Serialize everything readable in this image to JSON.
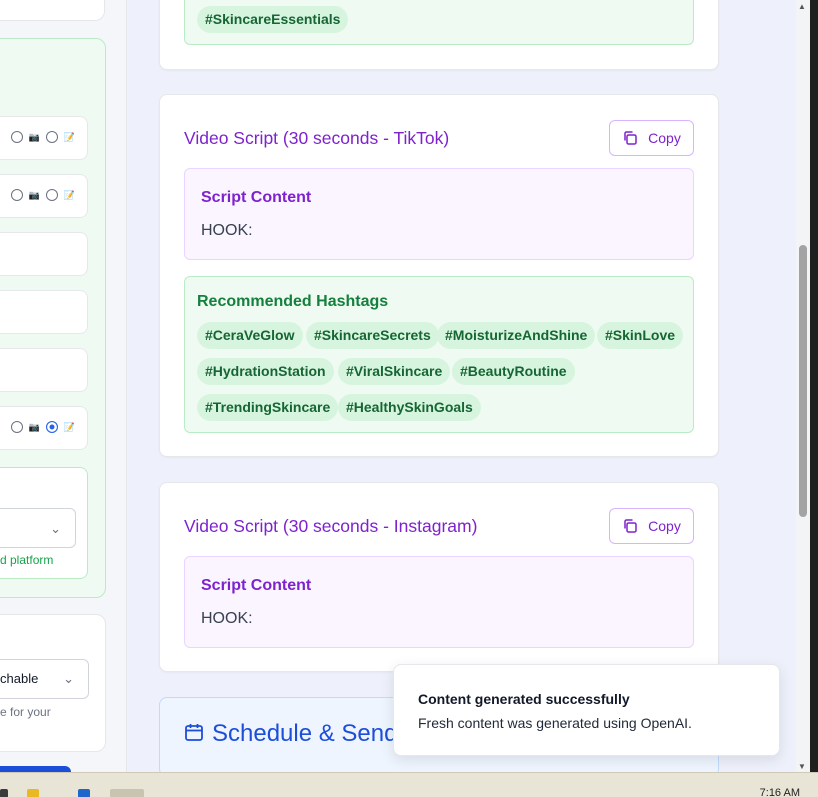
{
  "left_panel": {
    "platform_hint": "d platform",
    "select_value": "chable",
    "select_hint": "e for your"
  },
  "top_card": {
    "tags": [
      "#SkincareEssentials"
    ]
  },
  "tiktok_card": {
    "title": "Video Script (30 seconds - TikTok)",
    "copy_label": "Copy",
    "script_label": "Script Content",
    "script_text": "HOOK:",
    "hashtags_label": "Recommended Hashtags",
    "hashtags": [
      "#CeraVeGlow",
      "#SkincareSecrets",
      "#MoisturizeAndShine",
      "#SkinLove",
      "#HydrationStation",
      "#ViralSkincare",
      "#BeautyRoutine",
      "#TrendingSkincare",
      "#HealthySkinGoals"
    ]
  },
  "instagram_card": {
    "title": "Video Script (30 seconds - Instagram)",
    "copy_label": "Copy",
    "script_label": "Script Content",
    "script_text": "HOOK:"
  },
  "schedule": {
    "title": "Schedule & Send"
  },
  "toast": {
    "title": "Content generated successfully",
    "message": "Fresh content was generated using OpenAI."
  },
  "taskbar": {
    "clock": "7:16 AM"
  },
  "colors": {
    "accent_purple": "#7e22ce",
    "hashtag_green": "#166534",
    "schedule_blue": "#1d4ed8"
  }
}
